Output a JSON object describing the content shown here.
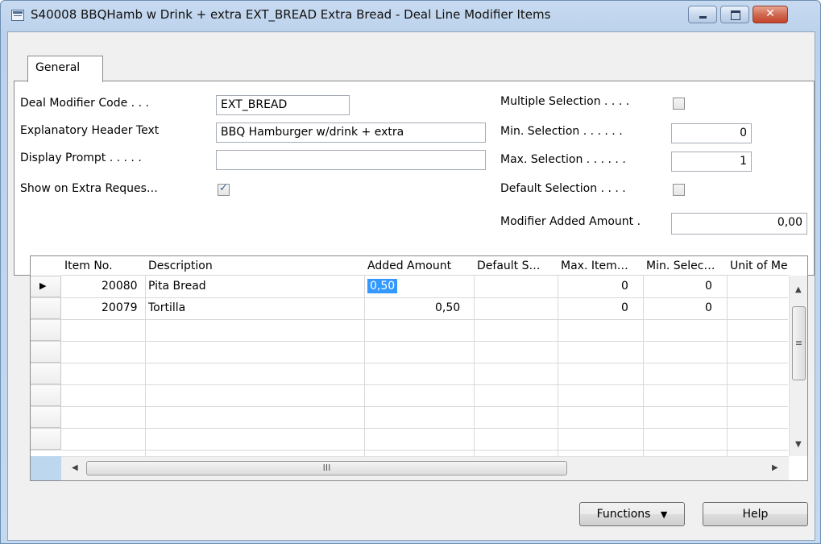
{
  "window": {
    "title": "S40008 BBQHamb w Drink + extra EXT_BREAD Extra Bread - Deal Line Modifier Items",
    "close_glyph": "✕"
  },
  "tabs": [
    {
      "label": "General"
    }
  ],
  "general": {
    "deal_modifier_code": {
      "label": "Deal Modifier Code . . .",
      "value": "EXT_BREAD"
    },
    "explanatory_header_text": {
      "label": "Explanatory Header Text",
      "value": "BBQ Hamburger w/drink + extra"
    },
    "display_prompt": {
      "label": "Display Prompt . . . . .",
      "value": ""
    },
    "show_on_extra_request": {
      "label": "Show on Extra Reques…",
      "checked": true
    },
    "multiple_selection": {
      "label": "Multiple Selection . . . .",
      "checked": false
    },
    "min_selection": {
      "label": "Min. Selection . . . . . .",
      "value": "0"
    },
    "max_selection": {
      "label": "Max. Selection . . . . . .",
      "value": "1"
    },
    "default_selection": {
      "label": "Default Selection . . . .",
      "checked": false
    },
    "modifier_added_amount": {
      "label": "Modifier Added Amount .",
      "value": "0,00"
    }
  },
  "grid": {
    "columns": [
      "Item No.",
      "Description",
      "Added Amount",
      "Default S…",
      "Max. Item…",
      "Min. Selec…",
      "Unit of Me"
    ],
    "rows": [
      {
        "item_no": "20080",
        "description": "Pita Bread",
        "added_amount": "0,50",
        "default_s": "",
        "max_item": "0",
        "min_selec": "0",
        "unit": ""
      },
      {
        "item_no": "20079",
        "description": "Tortilla",
        "added_amount": "0,50",
        "default_s": "",
        "max_item": "0",
        "min_selec": "0",
        "unit": ""
      }
    ],
    "current_row_marker": "▶",
    "hscroll_grip": "III",
    "vscroll_grip": "≡"
  },
  "buttons": {
    "functions": "Functions",
    "functions_arrow": "▼",
    "help": "Help"
  },
  "colors": {
    "selection": "#3399ff",
    "title_bar": "#c7daf0",
    "close_button": "#c5432a"
  }
}
